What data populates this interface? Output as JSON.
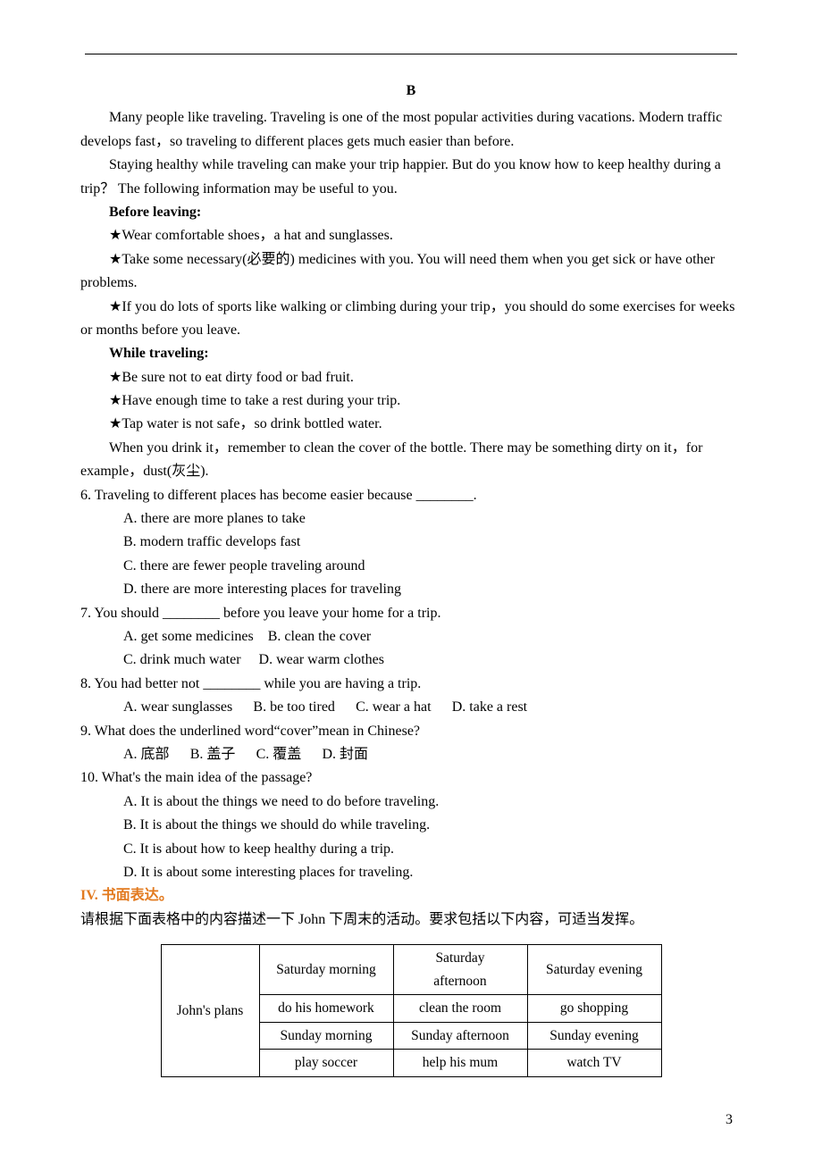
{
  "passage": {
    "label": "B",
    "p1": "Many people like traveling. Traveling is one of the most popular activities during vacations. Modern traffic develops fast，so traveling to different places gets much easier than before.",
    "p2": "Staying healthy while traveling can make your trip happier. But do you know how to keep healthy during a trip？ The following information may be useful to you.",
    "before_label": "Before leaving:",
    "b1": "★Wear comfortable shoes，a hat and sunglasses.",
    "b2": "★Take some necessary(必要的) medicines with you. You will need them when you get sick or have other problems.",
    "b3": "★If you do lots of sports like walking or climbing during your trip，you should do some exercises for weeks or months before you leave.",
    "while_label": "While traveling:",
    "w1": "★Be sure not to eat dirty food or bad fruit.",
    "w2": "★Have enough time to take a rest during your trip.",
    "w3": "★Tap water is not safe，so drink bottled water.",
    "p3": "When you drink it，remember to clean the cover of the bottle. There may be something dirty on it，for example，dust(灰尘)."
  },
  "questions": {
    "q6": {
      "stem": "6. Traveling to different places has become easier because ________.",
      "a": "A. there are more planes to take",
      "b": "B. modern traffic develops fast",
      "c": "C. there are fewer people traveling around",
      "d": "D. there are more interesting places for traveling"
    },
    "q7": {
      "stem": "7. You should ________ before you leave your home for a trip.",
      "ab": "A. get some medicines　B. clean the cover",
      "cd": "C. drink much water 　D. wear warm clothes"
    },
    "q8": {
      "stem": "8. You had better not ________ while you are having a trip.",
      "a": "A. wear sunglasses",
      "b": "B. be too tired",
      "c": "C. wear a hat",
      "d": "D. take a rest"
    },
    "q9": {
      "stem": "9. What does the underlined word“cover”mean in Chinese?",
      "a": "A. 底部",
      "b": "B. 盖子",
      "c": "C. 覆盖",
      "d": "D. 封面"
    },
    "q10": {
      "stem": "10. What's the main idea of the passage?",
      "a": "A. It is about the things we need to do before traveling.",
      "b": "B. It is about the things we should do while traveling.",
      "c": "C. It is about how to keep healthy during a trip.",
      "d": "D. It is about some interesting places for traveling."
    }
  },
  "writing": {
    "heading": "IV. 书面表达。",
    "prompt": "请根据下面表格中的内容描述一下 John 下周末的活动。要求包括以下内容，可适当发挥。"
  },
  "chart_data": {
    "type": "table",
    "row_header": "John's plans",
    "rows": [
      {
        "c1": "Saturday morning",
        "c2_l1": "Saturday",
        "c2_l2": "afternoon",
        "c3": "Saturday evening"
      },
      {
        "c1": "do his homework",
        "c2": "clean the room",
        "c3": "go shopping"
      },
      {
        "c1": "Sunday morning",
        "c2": "Sunday afternoon",
        "c3": "Sunday evening"
      },
      {
        "c1": "play soccer",
        "c2": "help his mum",
        "c3": "watch TV"
      }
    ]
  },
  "page_number": "3"
}
